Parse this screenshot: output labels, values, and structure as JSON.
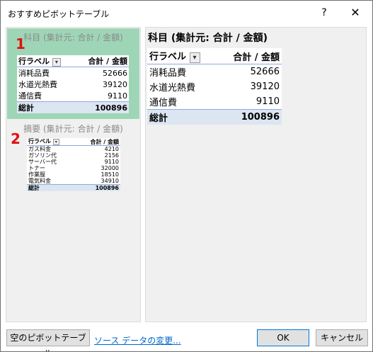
{
  "window": {
    "title": "おすすめピボットテーブル",
    "help_glyph": "?",
    "close_glyph": "✕"
  },
  "left": {
    "item1": {
      "marker": "1",
      "caption": "科目 (集計元: 合計 / 金額)",
      "header": {
        "label": "行ラベル",
        "value": "合計 / 金額"
      },
      "rows": [
        {
          "label": "消耗品費",
          "value": "52666"
        },
        {
          "label": "水道光熱費",
          "value": "39120"
        },
        {
          "label": "通信費",
          "value": "9110"
        }
      ],
      "total": {
        "label": "総計",
        "value": "100896"
      }
    },
    "item2": {
      "marker": "2",
      "caption": "摘要 (集計元: 合計 / 金額)",
      "header": {
        "label": "行ラベル",
        "value": "合計 / 金額"
      },
      "rows": [
        {
          "label": "ガス料金",
          "value": "4210"
        },
        {
          "label": "ガソリン代",
          "value": "2156"
        },
        {
          "label": "サーバー代",
          "value": "9110"
        },
        {
          "label": "トナー",
          "value": "32000"
        },
        {
          "label": "作業服",
          "value": "18510"
        },
        {
          "label": "電気料金",
          "value": "34910"
        }
      ],
      "total": {
        "label": "総計",
        "value": "100896"
      }
    }
  },
  "preview": {
    "title": "科目 (集計元: 合計 / 金額)",
    "header": {
      "label": "行ラベル",
      "value": "合計 / 金額"
    },
    "rows": [
      {
        "label": "消耗品費",
        "value": "52666"
      },
      {
        "label": "水道光熱費",
        "value": "39120"
      },
      {
        "label": "通信費",
        "value": "9110"
      }
    ],
    "total": {
      "label": "総計",
      "value": "100896"
    }
  },
  "footer": {
    "blank_pivot": "空のピボットテーブル",
    "change_source": "ソース データの変更...",
    "ok": "OK",
    "cancel": "キャンセル"
  },
  "icons": {
    "dropdown": "▾"
  },
  "colors": {
    "selected_card": "#9fd5b7",
    "marker": "#e01010",
    "link": "#0066cc",
    "total_row": "#dce6f2"
  }
}
